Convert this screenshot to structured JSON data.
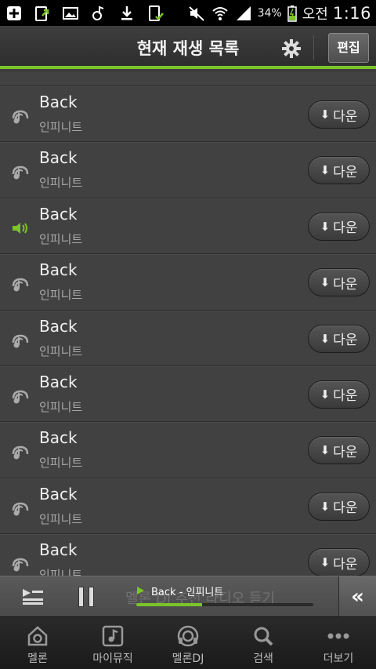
{
  "status_bar": {
    "battery": "34%",
    "ampm": "오전",
    "time": "1:16",
    "icons": [
      "add-icon",
      "upload-icon",
      "image-icon",
      "music-icon",
      "download-icon",
      "phone-check-icon",
      "mute-icon",
      "wifi-icon",
      "signal-icon",
      "battery-icon"
    ]
  },
  "header": {
    "title": "현재 재생 목록",
    "edit_label": "편집",
    "settings_icon": "gear-icon"
  },
  "tracks": [
    {
      "title": "Back",
      "artist": "인피니트",
      "download_label": "다운",
      "state": "idle"
    },
    {
      "title": "Back",
      "artist": "인피니트",
      "download_label": "다운",
      "state": "idle"
    },
    {
      "title": "Back",
      "artist": "인피니트",
      "download_label": "다운",
      "state": "playing"
    },
    {
      "title": "Back",
      "artist": "인피니트",
      "download_label": "다운",
      "state": "idle"
    },
    {
      "title": "Back",
      "artist": "인피니트",
      "download_label": "다운",
      "state": "idle"
    },
    {
      "title": "Back",
      "artist": "인피니트",
      "download_label": "다운",
      "state": "idle"
    },
    {
      "title": "Back",
      "artist": "인피니트",
      "download_label": "다운",
      "state": "idle"
    },
    {
      "title": "Back",
      "artist": "인피니트",
      "download_label": "다운",
      "state": "idle"
    },
    {
      "title": "Back",
      "artist": "인피니트",
      "download_label": "다운",
      "state": "idle"
    }
  ],
  "player": {
    "now_playing": "Back - 인피니트",
    "background_text": "멜론 DJ 추천 라디오 듣기",
    "progress": 0.37
  },
  "bottom_nav": [
    {
      "label": "멜론",
      "icon": "melon-home-icon"
    },
    {
      "label": "마이뮤직",
      "icon": "my-music-icon"
    },
    {
      "label": "멜론DJ",
      "icon": "headphones-icon"
    },
    {
      "label": "검색",
      "icon": "search-icon"
    },
    {
      "label": "더보기",
      "icon": "more-icon"
    }
  ],
  "colors": {
    "accent": "#7bc42a",
    "background": "#3c3c3c"
  }
}
